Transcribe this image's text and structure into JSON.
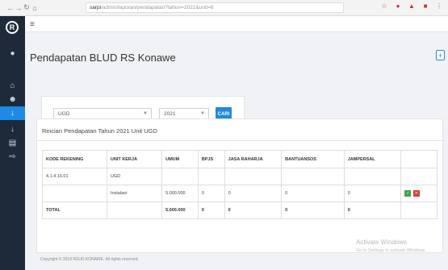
{
  "browser": {
    "url_domain": "sarpi",
    "url_path": "/admin/laporan/pendapatan?tahun=2021&unit=6",
    "icons": [
      "back-icon",
      "forward-icon",
      "reload-icon",
      "home-icon"
    ]
  },
  "page": {
    "title": "Pendapatan BLUD RS Konawe"
  },
  "filters": {
    "unit_value": "UGD",
    "year_value": "2021",
    "search_label": "CARI"
  },
  "card": {
    "heading": "Rincian Pendapatan Tahun 2021 Unit UGD"
  },
  "table": {
    "headers": [
      "KODE REKENING",
      "UNIT KERJA",
      "UMUM",
      "BPJS",
      "JASA RAHARJA",
      "BANTUANSOS",
      "JAMPERSAL",
      ""
    ],
    "rows": [
      [
        "4.1.4.16.01",
        "UGD",
        "",
        "",
        "",
        "",
        "",
        ""
      ],
      [
        "",
        "Instalasi",
        "5.000.000",
        "0",
        "0",
        "0",
        "0",
        ""
      ]
    ],
    "total": [
      "TOTAL",
      "",
      "5.000.000",
      "0",
      "0",
      "0",
      "0",
      ""
    ]
  },
  "watermark": {
    "line1": "Activate Windows",
    "line2": "Go to Settings to activate Windows."
  },
  "footer": {
    "text": "Copyright © 2019 RSUD KONAWE. All rights reserved."
  }
}
